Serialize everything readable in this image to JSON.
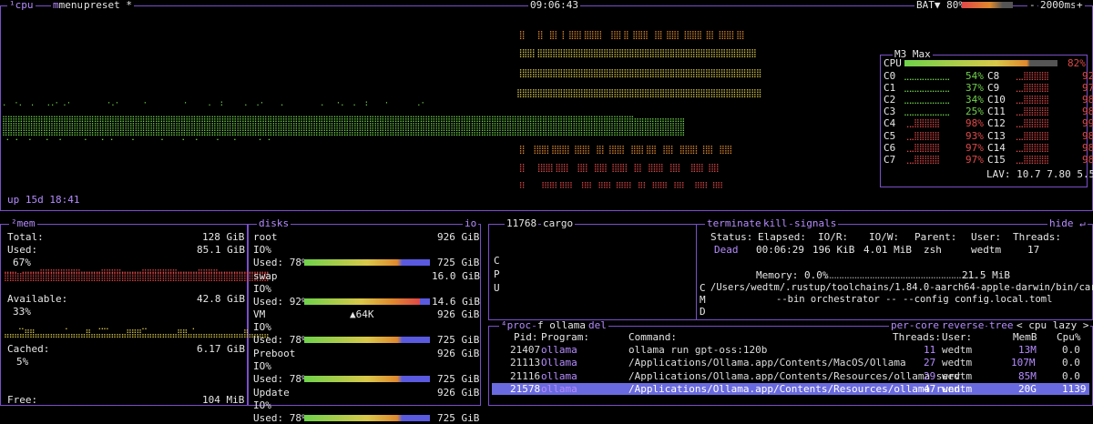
{
  "top": {
    "cpu_tab": "¹cpu",
    "menu_tab": "menu",
    "preset_tab": "preset *",
    "clock": "09:06:43",
    "battery": "BAT▼ 80%",
    "interval_minus": "-",
    "interval": "2000ms",
    "interval_plus": "+",
    "uptime": "up 15d 18:41"
  },
  "cpu_box": {
    "title": "M3 Max",
    "total_label": "CPU",
    "total_pct": "82%",
    "cores_left": [
      {
        "name": "C0",
        "pct": "54%",
        "level": 0.54
      },
      {
        "name": "C1",
        "pct": "37%",
        "level": 0.37
      },
      {
        "name": "C2",
        "pct": "34%",
        "level": 0.34
      },
      {
        "name": "C3",
        "pct": "25%",
        "level": 0.25
      },
      {
        "name": "C4",
        "pct": "98%",
        "level": 0.98
      },
      {
        "name": "C5",
        "pct": "93%",
        "level": 0.93
      },
      {
        "name": "C6",
        "pct": "97%",
        "level": 0.97
      },
      {
        "name": "C7",
        "pct": "97%",
        "level": 0.97
      }
    ],
    "cores_right": [
      {
        "name": "C8",
        "pct": "92%",
        "level": 0.92
      },
      {
        "name": "C9",
        "pct": "97%",
        "level": 0.97
      },
      {
        "name": "C10",
        "pct": "98%",
        "level": 0.98
      },
      {
        "name": "C11",
        "pct": "98%",
        "level": 0.98
      },
      {
        "name": "C12",
        "pct": "99%",
        "level": 0.99
      },
      {
        "name": "C13",
        "pct": "98%",
        "level": 0.98
      },
      {
        "name": "C14",
        "pct": "98%",
        "level": 0.98
      },
      {
        "name": "C15",
        "pct": "98%",
        "level": 0.98
      }
    ],
    "lav": "LAV: 10.7 7.80 5.52"
  },
  "mem": {
    "title": "²mem",
    "total_label": "Total:",
    "total_value": "128 GiB",
    "used_label": "Used:",
    "used_value": "85.1 GiB",
    "used_pct": "67%",
    "available_label": "Available:",
    "available_value": "42.8 GiB",
    "available_pct": "33%",
    "cached_label": "Cached:",
    "cached_value": "6.17 GiB",
    "cached_pct": "5%",
    "free_label": "Free:",
    "free_value": "104 MiB"
  },
  "disks": {
    "title": "disks",
    "io_label": "io",
    "items": [
      {
        "name": "root",
        "total": "926 GiB",
        "io": "IO%",
        "used_label": "Used: 78%",
        "used": "725 GiB",
        "level": 0.78
      },
      {
        "name": "swap",
        "total": "16.0 GiB",
        "io": "",
        "used_label": "Used: 92%",
        "used": "14.6 GiB",
        "level": 0.92
      },
      {
        "name": "VM",
        "total": "926 GiB",
        "io": "IO%",
        "used_label": "Used: 78%",
        "used": "725 GiB",
        "level": 0.78,
        "extra": "▲64K"
      },
      {
        "name": "Preboot",
        "total": "926 GiB",
        "io": "",
        "used_label": "Used: 78%",
        "used": "725 GiB",
        "level": 0.78
      },
      {
        "name": "Update",
        "total": "926 GiB",
        "io": "IO%",
        "used_label": "Used: 78%",
        "used": "725 GiB",
        "level": 0.78
      }
    ]
  },
  "detail": {
    "pid": "11768",
    "name": "cargo",
    "terminate": "terminate",
    "kill": "kill",
    "signals": "signals",
    "hide": "hide ↵",
    "col_status": "Status:",
    "col_elapsed": "Elapsed:",
    "col_ior": "IO/R:",
    "col_iow": "IO/W:",
    "col_parent": "Parent:",
    "col_user": "User:",
    "col_threads": "Threads:",
    "status": "Dead",
    "elapsed": "00:06:29",
    "ior": "196 KiB",
    "iow": "4.01 MiB",
    "parent": "zsh",
    "user": "wedtm",
    "threads": "17",
    "memory_label": "Memory: 0.0%",
    "memory_value": "21.5 MiB",
    "cmd_line1": "/Users/wedtm/.rustup/toolchains/1.84.0-aarch64-apple-darwin/bin/cargo run",
    "cmd_line2": "--bin orchestrator -- --config config.local.toml",
    "cpu_letters": [
      "C",
      "P",
      "U"
    ],
    "cmd_letters": [
      "C",
      "M",
      "D"
    ]
  },
  "proc": {
    "title": "⁴proc",
    "filter": "f ollama",
    "del": "del",
    "per_core": "per-core",
    "reverse": "reverse",
    "tree": "tree",
    "sort": "< cpu lazy >",
    "headers": {
      "pid": "Pid:",
      "program": "Program:",
      "command": "Command:",
      "threads": "Threads:",
      "user": "User:",
      "memb": "MemB",
      "cpu": "Cpu%"
    },
    "rows": [
      {
        "pid": "21407",
        "program": "ollama",
        "command": "ollama run gpt-oss:120b",
        "threads": "11",
        "user": "wedtm",
        "memb": "13M",
        "cpu": "0.0"
      },
      {
        "pid": "21113",
        "program": "Ollama",
        "command": "/Applications/Ollama.app/Contents/MacOS/Ollama",
        "threads": "27",
        "user": "wedtm",
        "memb": "107M",
        "cpu": "0.0"
      },
      {
        "pid": "21116",
        "program": "ollama",
        "command": "/Applications/Ollama.app/Contents/Resources/ollama serv",
        "threads": "29",
        "user": "wedtm",
        "memb": "85M",
        "cpu": "0.0"
      },
      {
        "pid": "21578",
        "program": "ollama",
        "command": "/Applications/Ollama.app/Contents/Resources/ollama runn",
        "threads": "47",
        "user": "wedtm",
        "memb": "20G",
        "cpu": "1139"
      }
    ]
  },
  "colors": {
    "border": "#7a4fc9",
    "accent": "#b58cff",
    "selected": "#6a6ae0",
    "green": "#6fd24a",
    "red": "#e04848"
  }
}
